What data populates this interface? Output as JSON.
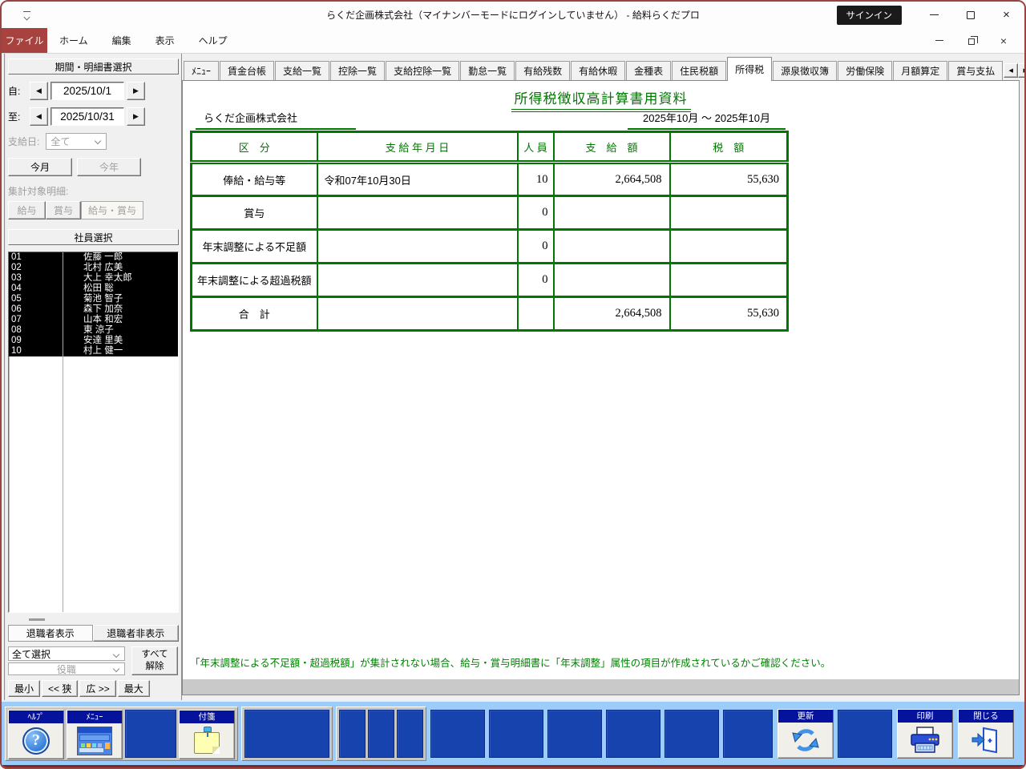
{
  "titlebar": {
    "title": "らくだ企画株式会社（マイナンバーモードにログインしていません） -  給料らくだプロ",
    "signin_label": "サインイン"
  },
  "menubar": {
    "items": [
      "ファイル",
      "ホーム",
      "編集",
      "表示",
      "ヘルプ"
    ]
  },
  "sidebar": {
    "period_header": "期間・明細書選択",
    "from_label": "自:",
    "from_value": "2025/10/1",
    "to_label": "至:",
    "to_value": "2025/10/31",
    "payday_label": "支給日:",
    "payday_value": "全て",
    "this_month_label": "今月",
    "this_year_label": "今年",
    "target_label": "集計対象明細:",
    "target_buttons": [
      "給与",
      "賞与",
      "給与・賞与"
    ],
    "target_selected": "給与・賞与",
    "employee_header": "社員選択",
    "employees": [
      {
        "code": "01",
        "name": "佐藤 一郎"
      },
      {
        "code": "02",
        "name": "北村 広美"
      },
      {
        "code": "03",
        "name": "大上 幸太郎"
      },
      {
        "code": "04",
        "name": "松田 聡"
      },
      {
        "code": "05",
        "name": "菊池 智子"
      },
      {
        "code": "06",
        "name": "森下 加奈"
      },
      {
        "code": "07",
        "name": "山本 和宏"
      },
      {
        "code": "08",
        "name": "東 涼子"
      },
      {
        "code": "09",
        "name": "安達 里美"
      },
      {
        "code": "10",
        "name": "村上 健一"
      }
    ],
    "show_retired_label": "退職者表示",
    "hide_retired_label": "退職者非表示",
    "select_all_value": "全て選択",
    "clear_all_label": "すべて\n解除",
    "position_value": "役職",
    "size_buttons": [
      "最小",
      "<< 狭",
      "広 >>",
      "最大"
    ]
  },
  "tabs": {
    "items": [
      "ﾒﾆｭｰ",
      "賃金台帳",
      "支給一覧",
      "控除一覧",
      "支給控除一覧",
      "勤怠一覧",
      "有給残数",
      "有給休暇",
      "金種表",
      "住民税額",
      "所得税",
      "源泉徴収簿",
      "労働保険",
      "月額算定",
      "賞与支払"
    ],
    "active": "所得税"
  },
  "report": {
    "title": "所得税徴収高計算書用資料",
    "company": "らくだ企画株式会社",
    "period": "2025年10月 ～ 2025年10月",
    "columns": [
      "区　分",
      "支 給 年 月 日",
      "人 員",
      "支　給　額",
      "税　額"
    ],
    "rows": [
      {
        "category": "俸給・給与等",
        "date": "令和07年10月30日",
        "count": "10",
        "amount": "2,664,508",
        "tax": "55,630"
      },
      {
        "category": "賞与",
        "date": "",
        "count": "0",
        "amount": "",
        "tax": ""
      },
      {
        "category": "年末調整による不足額",
        "date": "",
        "count": "0",
        "amount": "",
        "tax": ""
      },
      {
        "category": "年末調整による超過税額",
        "date": "",
        "count": "0",
        "amount": "",
        "tax": ""
      },
      {
        "category": "合　計",
        "date": "",
        "count": "",
        "amount": "2,664,508",
        "tax": "55,630"
      }
    ],
    "note": "「年末調整による不足額・超過税額」が集計されない場合、給与・賞与明細書に「年末調整」属性の項目が作成されているかご確認ください。"
  },
  "toolbar": {
    "help_label": "ﾍﾙﾌﾟ",
    "menu_label": "ﾒﾆｭｰ",
    "sticky_label": "付箋",
    "refresh_label": "更新",
    "print_label": "印刷",
    "close_label": "閉じる"
  },
  "colors": {
    "accent_red": "#a8423e",
    "report_green": "#007700",
    "toolbar_tile_blue": "#1643ad",
    "toolbar_bg_blue": "#9ccdfa",
    "label_bar_navy": "#05129c"
  }
}
